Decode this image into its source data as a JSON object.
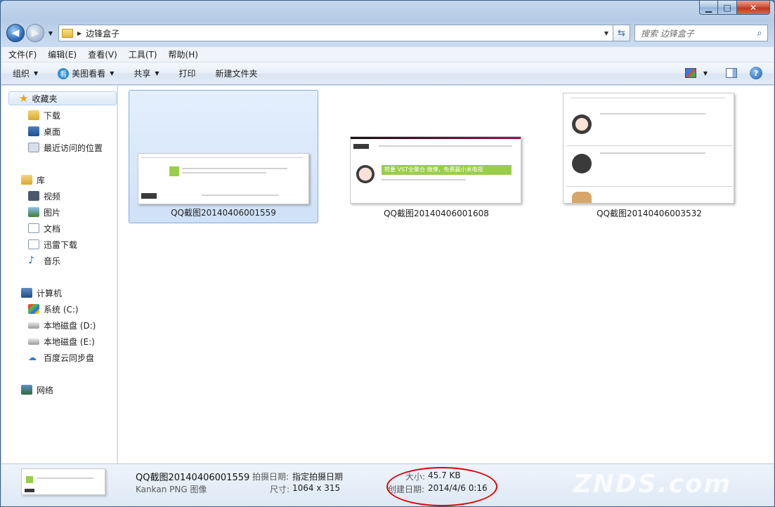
{
  "window": {
    "caption_buttons": [
      "minimize",
      "maximize",
      "close"
    ]
  },
  "nav": {
    "address": "边锋盒子",
    "search_placeholder": "搜索 边锋盒子"
  },
  "menu": [
    "文件(F)",
    "编辑(E)",
    "查看(V)",
    "工具(T)",
    "帮助(H)"
  ],
  "toolbar": {
    "organize": "组织",
    "meitu": "美图看看",
    "share": "共享",
    "print": "打印",
    "new_folder": "新建文件夹"
  },
  "sidebar": {
    "favorites": "收藏夹",
    "downloads": "下载",
    "desktop": "桌面",
    "recent": "最近访问的位置",
    "libraries": "库",
    "videos": "视频",
    "pictures": "图片",
    "documents": "文档",
    "xunlei": "迅雷下载",
    "music": "音乐",
    "computer": "计算机",
    "drive_c": "系统 (C:)",
    "drive_d": "本地磁盘 (D:)",
    "drive_e": "本地磁盘 (E:)",
    "baidu": "百度云同步盘",
    "network": "网络"
  },
  "files": [
    {
      "name": "QQ截图20140406001559",
      "selected": true
    },
    {
      "name": "QQ截图20140406001608",
      "selected": false
    },
    {
      "name": "QQ截图20140406003532",
      "selected": false
    }
  ],
  "thumb_text": {
    "banner": "转要 VST全聚合 微博，免费赢小米电视"
  },
  "details": {
    "name": "QQ截图20140406001559",
    "type": "Kankan PNG 图像",
    "date_taken_label": "拍摄日期:",
    "date_taken_value": "指定拍摄日期",
    "dimensions_label": "尺寸:",
    "dimensions_value": "1064 x 315",
    "size_label": "大小:",
    "size_value": "45.7 KB",
    "created_label": "创建日期:",
    "created_value": "2014/4/6 0:16"
  },
  "watermark": "ZNDS.com"
}
